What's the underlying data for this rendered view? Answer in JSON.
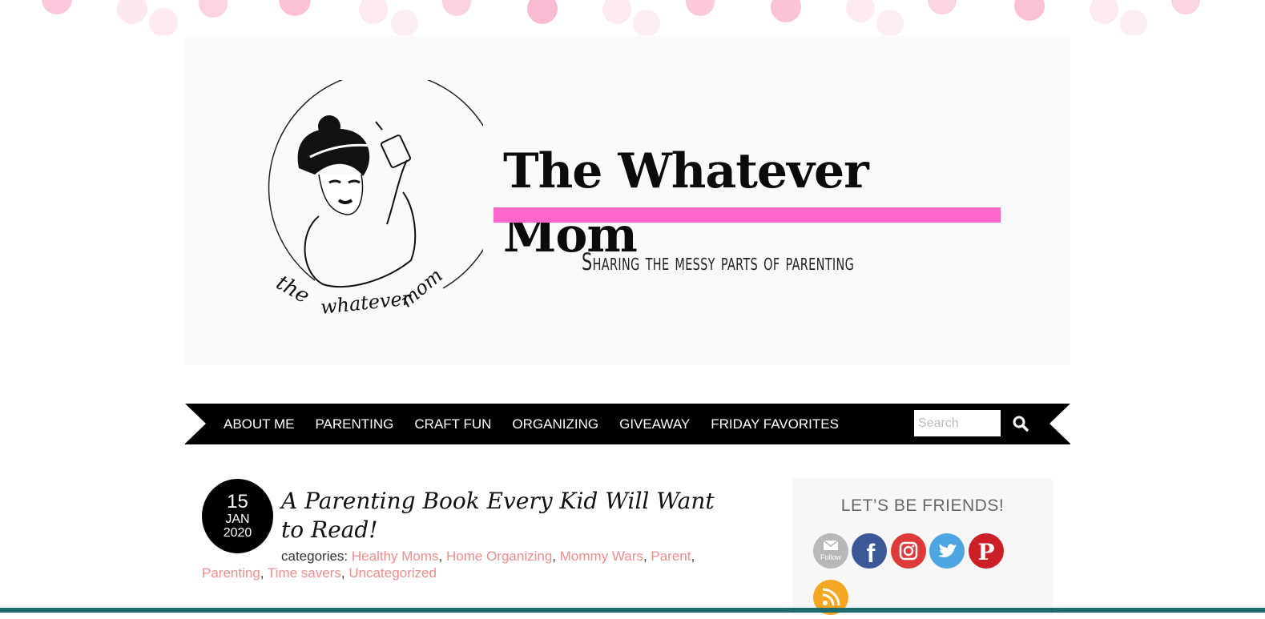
{
  "header": {
    "site_title": "The Whatever Mom",
    "tagline": "Sharing the messy parts of parenting",
    "logo_script": "the whatever mom",
    "accent_color": "#ff66cc"
  },
  "nav": {
    "items": [
      "ABOUT ME",
      "PARENTING",
      "CRAFT FUN",
      "ORGANIZING",
      "GIVEAWAY",
      "FRIDAY FAVORITES"
    ],
    "search_placeholder": "Search",
    "search_icon": "search-icon"
  },
  "post": {
    "day": "15",
    "month": "JAN",
    "year": "2020",
    "title": "A Parenting Book Every Kid Will Want to Read!",
    "categories_label": "categories:",
    "categories": [
      "Healthy Moms",
      "Home Organizing",
      "Mommy Wars",
      "Parent",
      "Parenting",
      "Time savers",
      "Uncategorized"
    ],
    "link_color": "#f08d8d"
  },
  "sidebar": {
    "widget_title": "LET’S BE FRIENDS!",
    "follow_label": "Follow",
    "social_icons": [
      "email-follow-icon",
      "facebook-icon",
      "instagram-icon",
      "twitter-icon",
      "pinterest-icon",
      "rss-icon"
    ]
  }
}
